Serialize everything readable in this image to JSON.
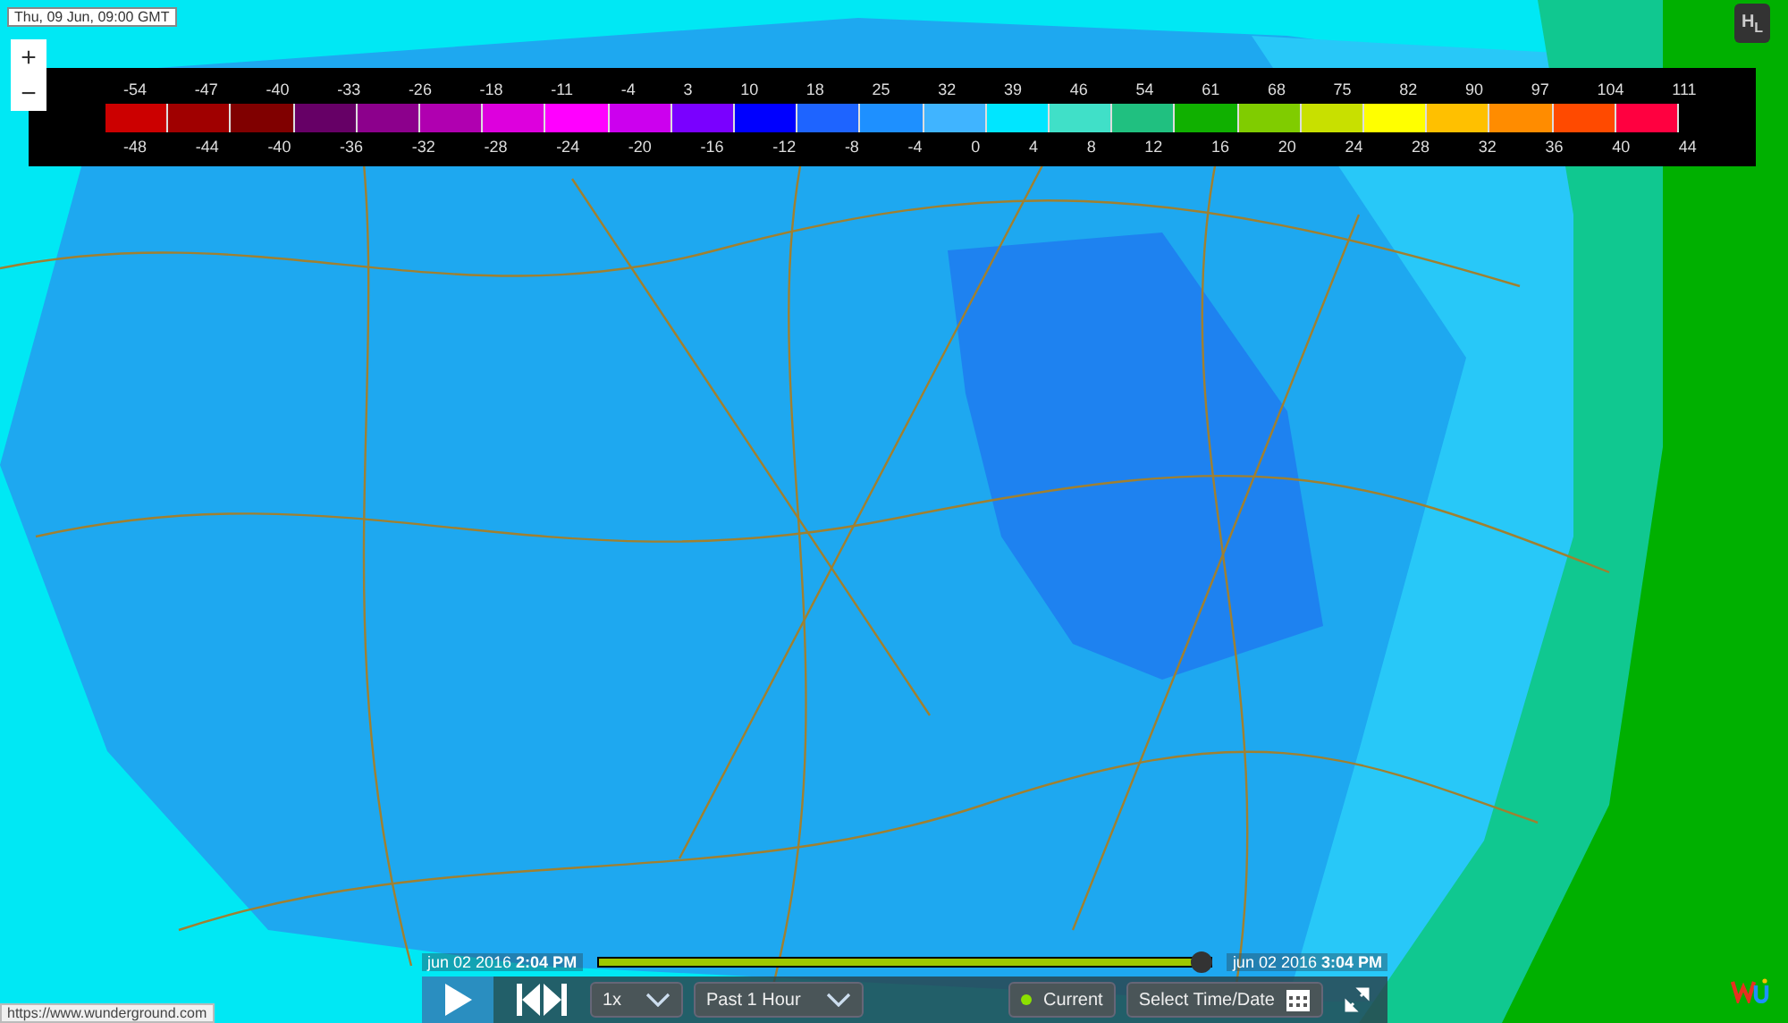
{
  "timestamp": "Thu, 09 Jun, 09:00 GMT",
  "zoom": {
    "in": "+",
    "out": "−"
  },
  "legend": {
    "top_ticks": [
      "-54",
      "-47",
      "-40",
      "-33",
      "-26",
      "-18",
      "-11",
      "-4",
      "3",
      "10",
      "18",
      "25",
      "32",
      "39",
      "46",
      "54",
      "61",
      "68",
      "75",
      "82",
      "90",
      "97",
      "104",
      "111"
    ],
    "bottom_ticks": [
      "-48",
      "-44",
      "-40",
      "-36",
      "-32",
      "-28",
      "-24",
      "-20",
      "-16",
      "-12",
      "-8",
      "-4",
      "0",
      "4",
      "8",
      "12",
      "16",
      "20",
      "24",
      "28",
      "32",
      "36",
      "40",
      "44"
    ],
    "swatches": [
      {
        "color": "#cc0000"
      },
      {
        "color": "#a00000"
      },
      {
        "color": "#800000"
      },
      {
        "color": "#660066"
      },
      {
        "color": "#8c008c"
      },
      {
        "color": "#b000b0"
      },
      {
        "color": "#dd00dd"
      },
      {
        "color": "#ff00ff"
      },
      {
        "color": "#cc00ee"
      },
      {
        "color": "#7a00ff"
      },
      {
        "color": "#0000ff"
      },
      {
        "color": "#1e64ff"
      },
      {
        "color": "#1e90ff"
      },
      {
        "color": "#40b4ff"
      },
      {
        "color": "#00e6ff"
      },
      {
        "color": "#40e0c8"
      },
      {
        "color": "#20c080"
      },
      {
        "color": "#10b000"
      },
      {
        "color": "#80cc00"
      },
      {
        "color": "#c8e000"
      },
      {
        "color": "#ffff00"
      },
      {
        "color": "#ffc000"
      },
      {
        "color": "#ff8c00"
      },
      {
        "color": "#ff4a00"
      },
      {
        "color": "#ff0040"
      }
    ]
  },
  "hl_toggle": {
    "label": "H",
    "sub": "L"
  },
  "timeline": {
    "start_date": "jun 02 2016",
    "start_time": "2:04 PM",
    "end_date": "jun 02 2016",
    "end_time": "3:04 PM",
    "level": 1
  },
  "controls": {
    "speed": "1x",
    "range": "Past 1 Hour",
    "current": "Current",
    "current_on": true,
    "select": "Select Time/Date"
  },
  "status_url": "https://www.wunderground.com"
}
